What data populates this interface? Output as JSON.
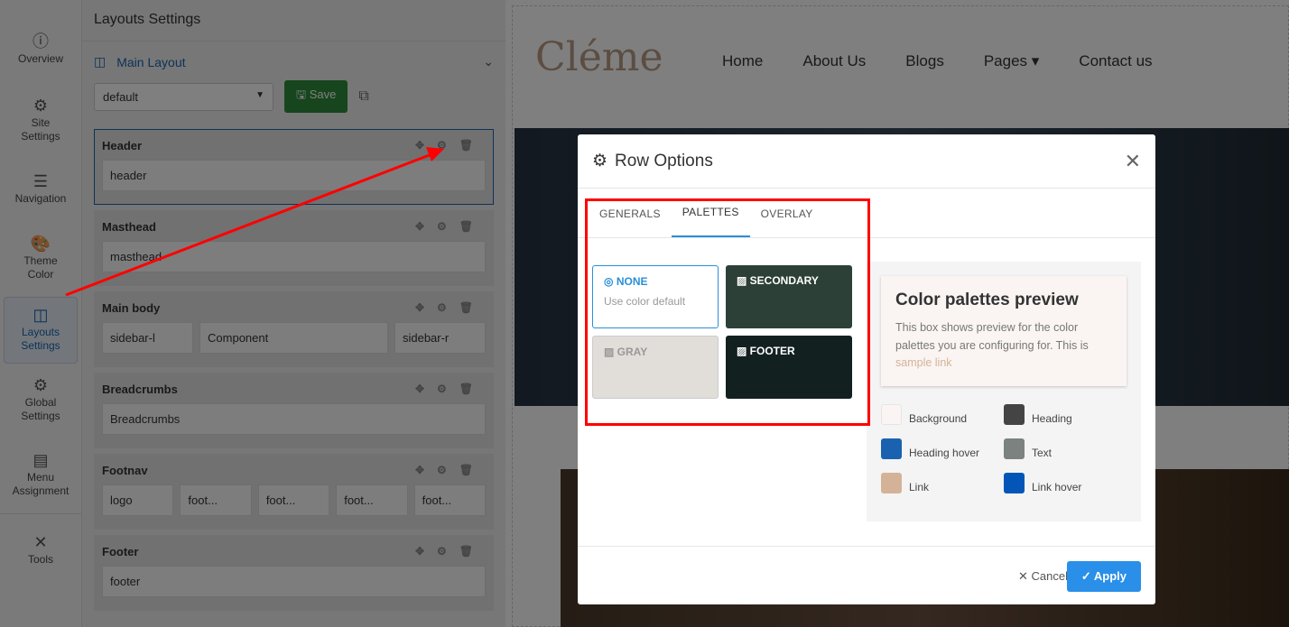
{
  "nav": [
    {
      "label": "Overview",
      "icon": "ⓘ"
    },
    {
      "label": "Site Settings",
      "icon": "⚙"
    },
    {
      "label": "Navigation",
      "icon": "☰"
    },
    {
      "label": "Theme Color",
      "icon": "🎨"
    },
    {
      "label": "Layouts Settings",
      "icon": "◫"
    },
    {
      "label": "Global Settings",
      "icon": "⚙"
    },
    {
      "label": "Menu Assignment",
      "icon": "▤"
    },
    {
      "label": "Tools",
      "icon": "✕"
    }
  ],
  "panel": {
    "title": "Layouts Settings",
    "main_layout": "Main Layout",
    "select_value": "default",
    "save": "Save",
    "sections": [
      {
        "title": "Header",
        "cells": [
          "header"
        ]
      },
      {
        "title": "Masthead",
        "cells": [
          "masthead"
        ]
      },
      {
        "title": "Main body",
        "cells": [
          "sidebar-l",
          "Component",
          "sidebar-r"
        ]
      },
      {
        "title": "Breadcrumbs",
        "cells": [
          "Breadcrumbs"
        ]
      },
      {
        "title": "Footnav",
        "cells": [
          "logo",
          "foot...",
          "foot...",
          "foot...",
          "foot..."
        ]
      },
      {
        "title": "Footer",
        "cells": [
          "footer"
        ]
      }
    ]
  },
  "site": {
    "logo": "Cléme",
    "menu": [
      "Home",
      "About Us",
      "Blogs",
      "Pages ▾",
      "Contact us"
    ]
  },
  "modal": {
    "title": "Row Options",
    "tabs": [
      "GENERALS",
      "PALETTES",
      "OVERLAY"
    ],
    "palettes": [
      {
        "name": "NONE",
        "sub": "Use color default"
      },
      {
        "name": "SECONDARY",
        "color": "#2c4038"
      },
      {
        "name": "GRAY",
        "color": "#e1ddd8"
      },
      {
        "name": "FOOTER",
        "color": "#132020"
      }
    ],
    "preview": {
      "title": "Color palettes preview",
      "text": "This box shows preview for the color palettes you are configuring for. This is",
      "link": "sample link"
    },
    "swatches": [
      {
        "label": "Background",
        "color": "#faf5f2"
      },
      {
        "label": "Heading",
        "color": "#444444"
      },
      {
        "label": "Heading hover",
        "color": "#1a62b0"
      },
      {
        "label": "Text",
        "color": "#7b8280"
      },
      {
        "label": "Link",
        "color": "#d4b298"
      },
      {
        "label": "Link hover",
        "color": "#0356b8"
      }
    ],
    "cancel": "✕ Cancel",
    "apply": "✓ Apply"
  }
}
